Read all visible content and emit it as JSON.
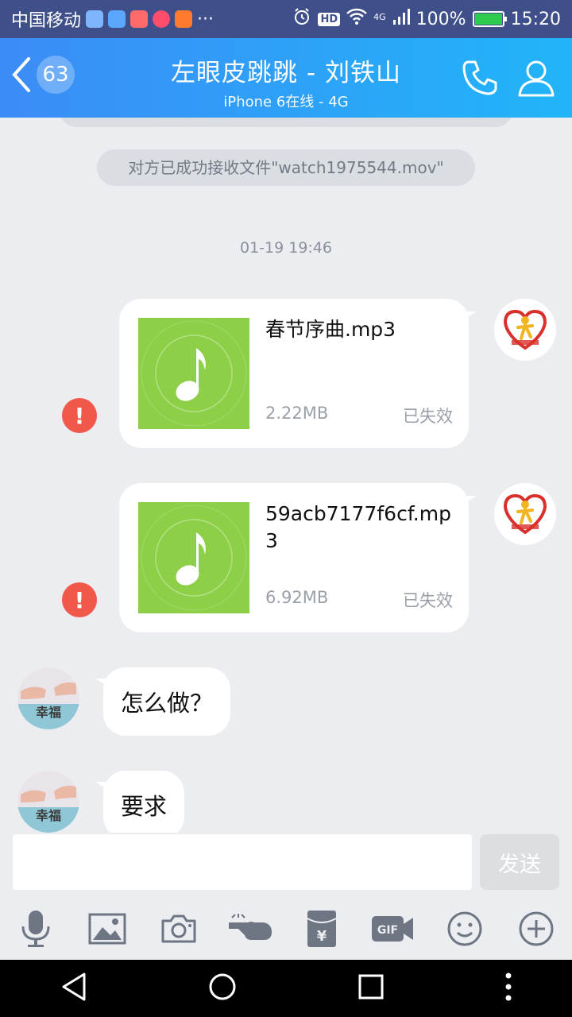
{
  "status_bar": {
    "carrier": "中国移动",
    "more": "···",
    "hd": "HD",
    "network": "4G",
    "battery": "100%",
    "time": "15:20"
  },
  "header": {
    "unread_count": "63",
    "title": "左眼皮跳跳 - 刘铁山",
    "subtitle": "iPhone 6在线 - 4G"
  },
  "chat": {
    "system_notice": "对方已成功接收文件\"watch1975544.mov\"",
    "timestamp": "01-19 19:46",
    "files": [
      {
        "name": "春节序曲.mp3",
        "size": "2.22MB",
        "status": "已失效"
      },
      {
        "name": "59acb7177f6cf.mp3",
        "size": "6.92MB",
        "status": "已失效"
      }
    ],
    "messages": [
      {
        "text": "怎么做？"
      },
      {
        "text": "要求"
      }
    ],
    "avatar_text": "幸福"
  },
  "input": {
    "placeholder": "",
    "send_label": "发送"
  },
  "toolbar": {
    "gif_label": "GIF",
    "icons": [
      "microphone-icon",
      "image-icon",
      "camera-icon",
      "poke-icon",
      "red-packet-icon",
      "gif-icon",
      "emoji-icon",
      "plus-icon"
    ]
  },
  "colors": {
    "header_start": "#3b8cf6",
    "header_end": "#21b5f8",
    "file_thumb": "#8dcf46",
    "warning": "#f0584a"
  }
}
